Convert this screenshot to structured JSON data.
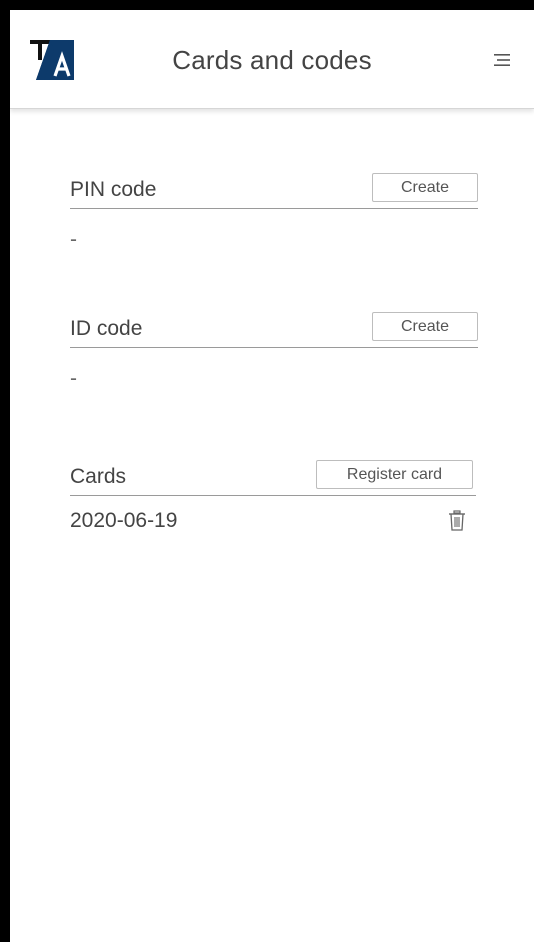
{
  "header": {
    "logo_text": "TA",
    "title": "Cards and codes",
    "menu_icon": "hamburger-icon"
  },
  "sections": {
    "pin": {
      "label": "PIN code",
      "button": "Create",
      "value": "-"
    },
    "id": {
      "label": "ID code",
      "button": "Create",
      "value": "-"
    },
    "cards": {
      "label": "Cards",
      "button": "Register card",
      "items": [
        {
          "date": "2020-06-19",
          "icon": "trash-icon"
        }
      ]
    }
  },
  "colors": {
    "logo_blue": "#0d3a6b",
    "text": "#444444",
    "divider": "#9a9a9a"
  }
}
